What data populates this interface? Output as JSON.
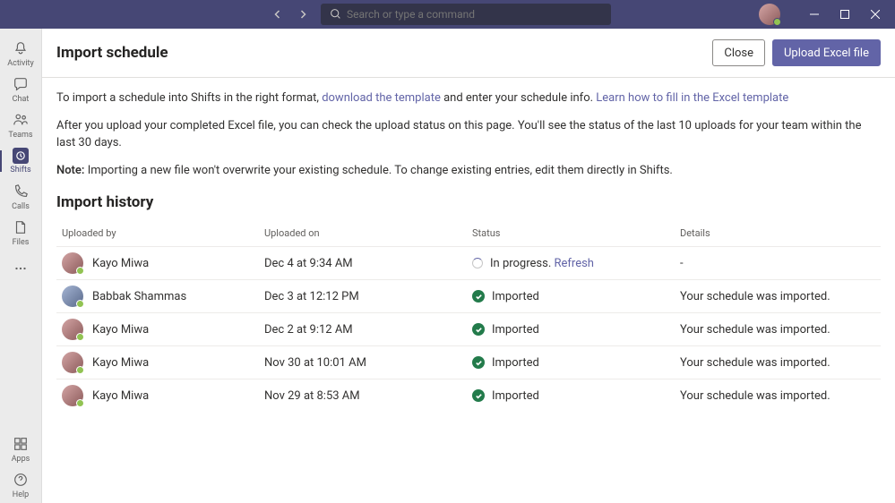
{
  "search": {
    "placeholder": "Search or type a command"
  },
  "sidebar": {
    "items": [
      {
        "label": "Activity"
      },
      {
        "label": "Chat"
      },
      {
        "label": "Teams"
      },
      {
        "label": "Shifts"
      },
      {
        "label": "Calls"
      },
      {
        "label": "Files"
      }
    ],
    "bottom": [
      {
        "label": "Apps"
      },
      {
        "label": "Help"
      }
    ]
  },
  "header": {
    "title": "Import schedule",
    "close": "Close",
    "upload": "Upload Excel file"
  },
  "intro": {
    "p1a": "To import a schedule into Shifts in the right format, ",
    "link1": "download the template",
    "p1b": " and enter your schedule info. ",
    "link2": "Learn how to fill in the Excel template",
    "p2": "After you upload your completed Excel file, you can check the upload status on this page. You'll see the status of the last 10 uploads for your team within the last 30 days.",
    "noteLabel": "Note:",
    "noteText": " Importing a new file won't overwrite your existing schedule. To change existing entries, edit them directly in Shifts."
  },
  "history": {
    "title": "Import history",
    "columns": {
      "uploadedBy": "Uploaded by",
      "uploadedOn": "Uploaded on",
      "status": "Status",
      "details": "Details"
    },
    "refresh": "Refresh",
    "rows": [
      {
        "name": "Kayo Miwa",
        "time": "Dec 4 at 9:34 AM",
        "status": "In progress.",
        "details": "-",
        "inProgress": true
      },
      {
        "name": "Babbak Shammas",
        "time": "Dec 3 at 12:12 PM",
        "status": "Imported",
        "details": "Your schedule was imported."
      },
      {
        "name": "Kayo Miwa",
        "time": "Dec 2 at 9:12 AM",
        "status": "Imported",
        "details": "Your schedule was imported."
      },
      {
        "name": "Kayo Miwa",
        "time": "Nov 30 at 10:01 AM",
        "status": "Imported",
        "details": "Your schedule was imported."
      },
      {
        "name": "Kayo Miwa",
        "time": "Nov 29 at 8:53 AM",
        "status": "Imported",
        "details": "Your schedule was imported."
      }
    ]
  }
}
